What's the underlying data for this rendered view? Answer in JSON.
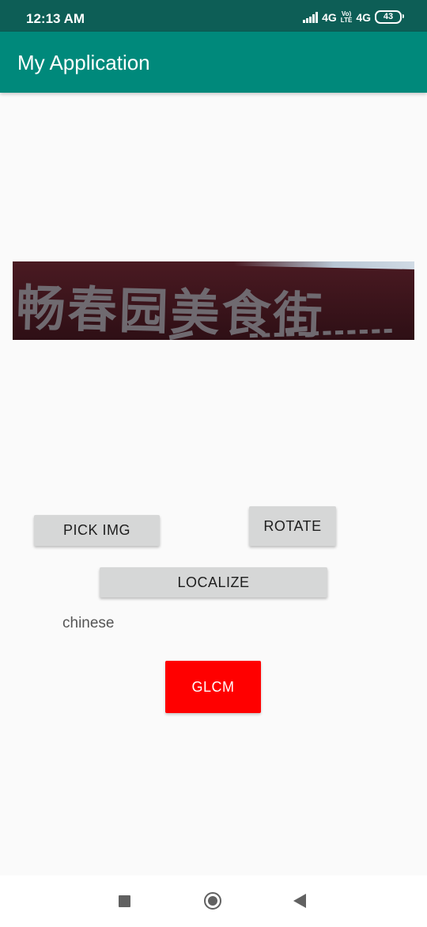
{
  "status_bar": {
    "time": "12:13 AM",
    "network_1": "4G",
    "volte_top": "Vo)",
    "volte_bottom": "LTE",
    "network_2": "4G",
    "battery": "43"
  },
  "app_bar": {
    "title": "My Application"
  },
  "image": {
    "sign_text": "畅春园美食街"
  },
  "buttons": {
    "pick_img": "PICK IMG",
    "rotate": "ROTATE",
    "localize": "LOCALIZE",
    "glcm": "GLCM"
  },
  "result": {
    "label": "chinese"
  },
  "colors": {
    "status_bar": "#0d5e56",
    "app_bar": "#00897b",
    "glcm_button": "#ff0000",
    "default_button": "#d6d7d7",
    "background": "#fafafa"
  },
  "nav_bar": {
    "icons": [
      "recents-icon",
      "home-icon",
      "back-icon"
    ]
  }
}
